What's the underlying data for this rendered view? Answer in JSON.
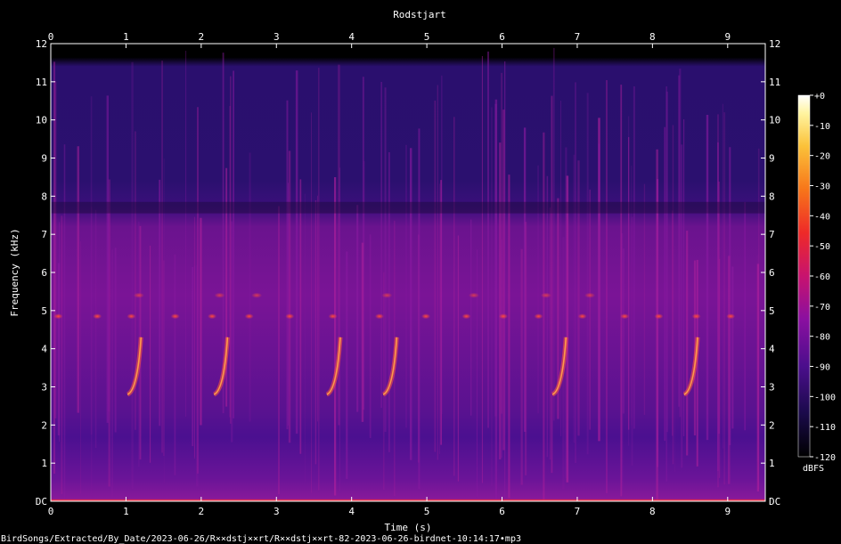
{
  "chart_data": {
    "type": "heatmap",
    "title": "Rodstjart",
    "xlabel": "Time (s)",
    "ylabel": "Frequency (kHz)",
    "xlim": [
      0,
      9.5
    ],
    "ylim": [
      0,
      12
    ],
    "x_ticks": [
      "0",
      "1",
      "2",
      "3",
      "4",
      "5",
      "6",
      "7",
      "8",
      "9"
    ],
    "y_ticks": [
      "DC",
      "1",
      "2",
      "3",
      "4",
      "5",
      "6",
      "7",
      "8",
      "9",
      "10",
      "11",
      "12"
    ],
    "colorbar": {
      "label": "dBFS",
      "range": [
        -120,
        0
      ],
      "ticks": [
        "+0",
        "-10",
        "-20",
        "-30",
        "-40",
        "-50",
        "-60",
        "-70",
        "-80",
        "-90",
        "-100",
        "-110",
        "-120"
      ],
      "colors": [
        "#000000",
        "#1a0a4a",
        "#4b0e8c",
        "#8a0fa0",
        "#c8136e",
        "#ee2a28",
        "#f7761a",
        "#fbc23a",
        "#fff4a0",
        "#ffffff"
      ]
    },
    "song_phrase_times_s": [
      1.2,
      2.35,
      3.85,
      4.6,
      6.85,
      8.6
    ],
    "background_level_dbfs": -95
  },
  "footer": {
    "file_path": "BirdSongs/Extracted/By_Date/2023-06-26/R××dstj××rt/R××dstj××rt-82-2023-06-26-birdnet-10:14:17•mp3"
  }
}
